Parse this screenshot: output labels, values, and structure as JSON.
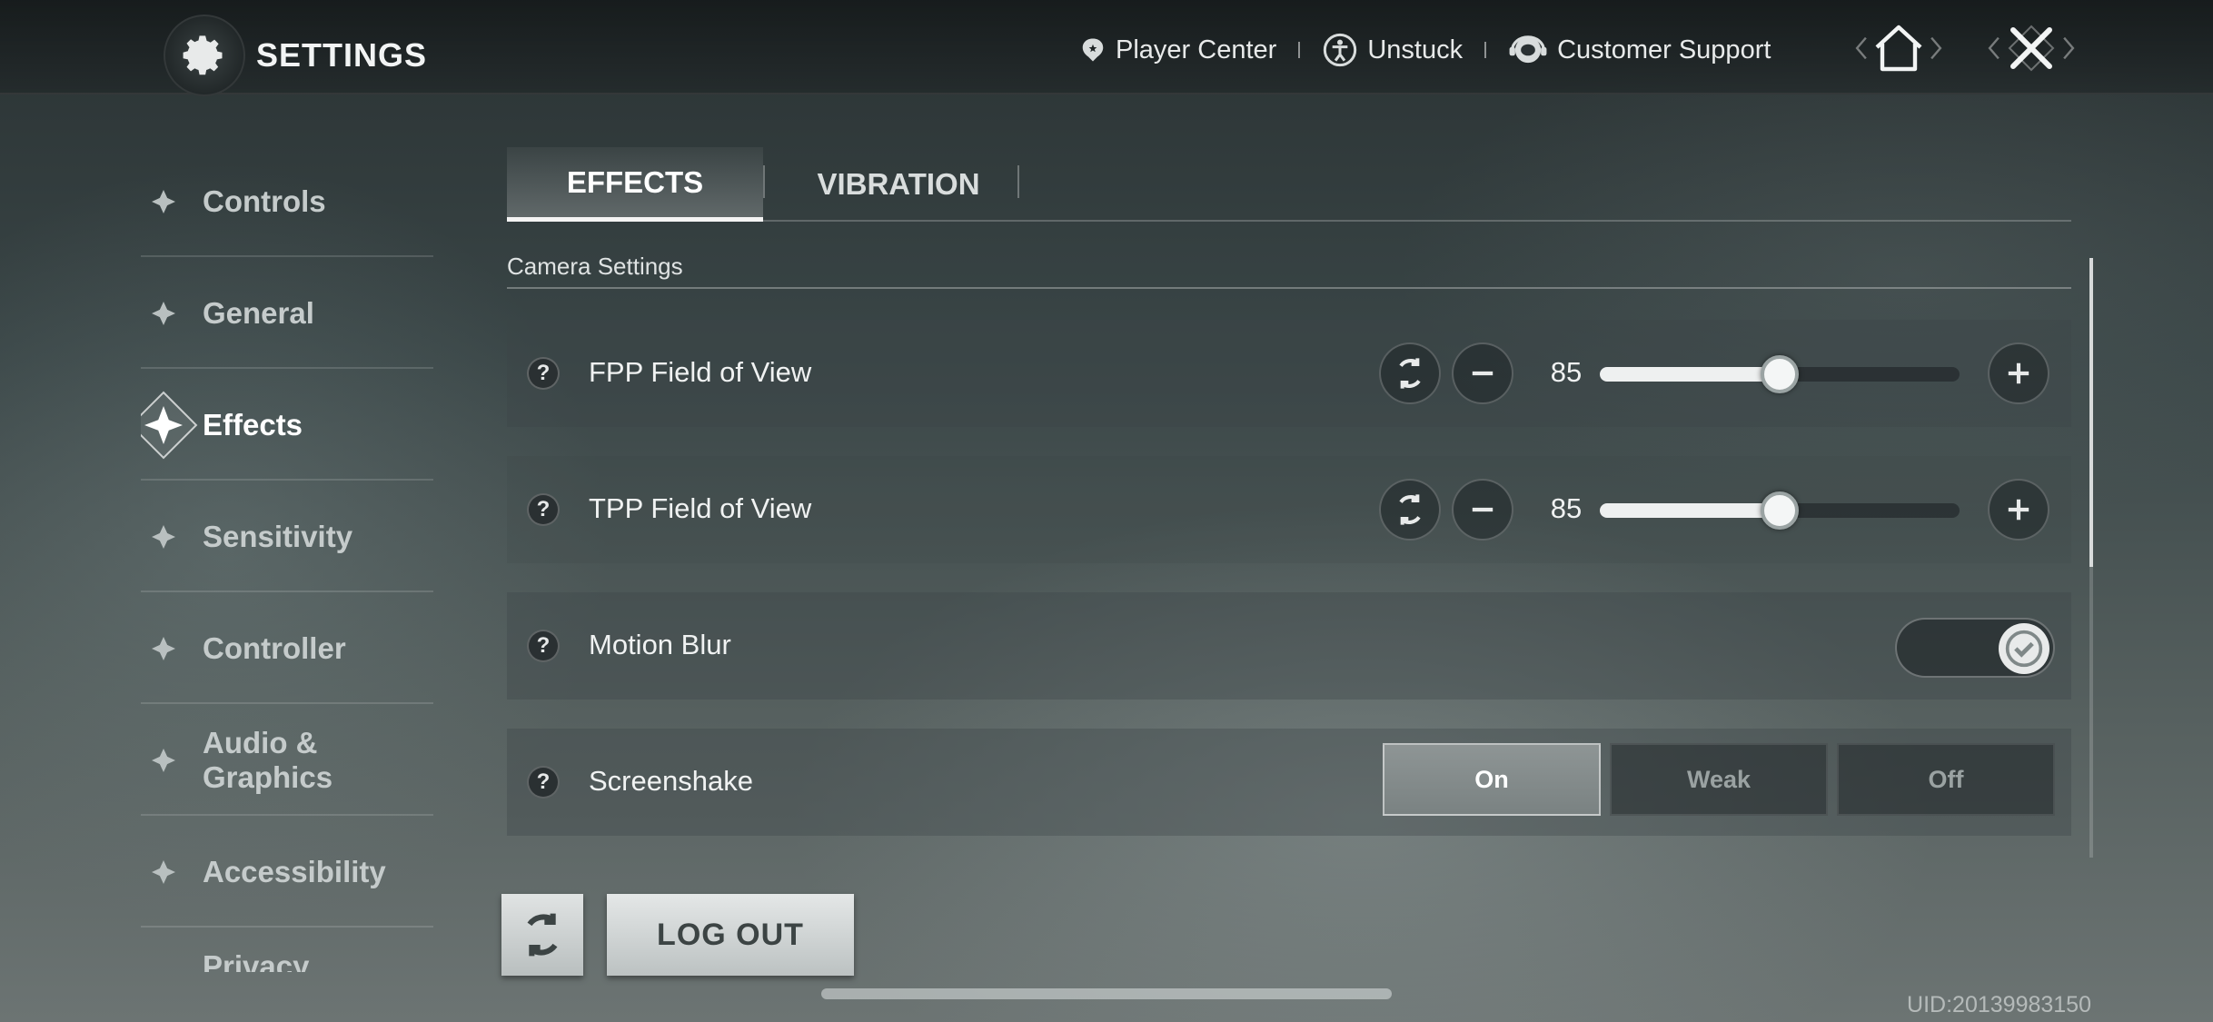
{
  "header": {
    "title": "SETTINGS",
    "links": [
      {
        "label": "Player Center",
        "icon": "player-center-icon"
      },
      {
        "label": "Unstuck",
        "icon": "unstuck-icon"
      },
      {
        "label": "Customer Support",
        "icon": "customer-support-icon"
      }
    ],
    "home_icon": "home-icon",
    "close_icon": "close-icon"
  },
  "sidebar": {
    "items": [
      {
        "label": "Controls",
        "active": false
      },
      {
        "label": "General",
        "active": false
      },
      {
        "label": "Effects",
        "active": true
      },
      {
        "label": "Sensitivity",
        "active": false
      },
      {
        "label": "Controller",
        "active": false
      },
      {
        "label": "Audio & Graphics",
        "active": false
      },
      {
        "label": "Accessibility",
        "active": false
      },
      {
        "label": "Privacy Settings",
        "active": false
      }
    ]
  },
  "tabs": [
    {
      "label": "EFFECTS",
      "active": true
    },
    {
      "label": "VIBRATION",
      "active": false
    }
  ],
  "section": {
    "title": "Camera Settings"
  },
  "settings": {
    "fpp": {
      "label": "FPP Field of View",
      "value": "85",
      "fill_percent": 50
    },
    "tpp": {
      "label": "TPP Field of View",
      "value": "85",
      "fill_percent": 50
    },
    "motion_blur": {
      "label": "Motion Blur",
      "enabled": true
    },
    "screenshake": {
      "label": "Screenshake",
      "options": [
        "On",
        "Weak",
        "Off"
      ],
      "selected": "On"
    }
  },
  "help_glyph": "?",
  "footer": {
    "logout_label": "LOG OUT",
    "uid": "UID:20139983150"
  },
  "colors": {
    "accent": "#f4f6f6",
    "background": "#3a4647"
  }
}
